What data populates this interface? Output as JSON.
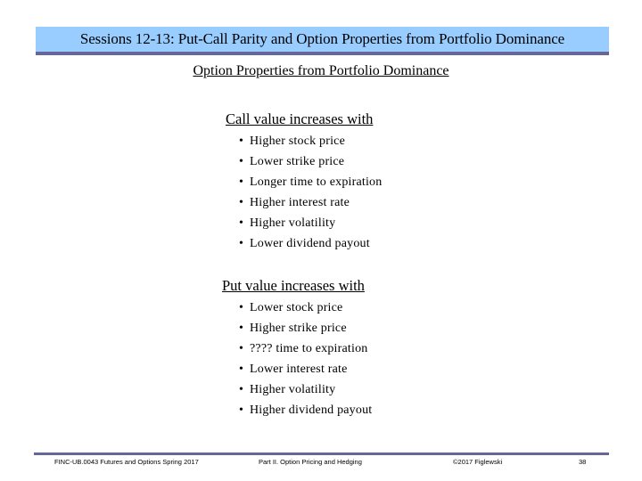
{
  "header": {
    "title": "Sessions 12-13:  Put-Call Parity and Option Properties from Portfolio Dominance",
    "band_color": "#99ccff",
    "rule_color": "#666699"
  },
  "subtitle": "Option Properties from Portfolio Dominance",
  "call_section": {
    "heading": "Call value increases with",
    "items": [
      "Higher stock price",
      "Lower strike price",
      "Longer time to expiration",
      "Higher interest rate",
      "Higher volatility",
      "Lower dividend payout"
    ]
  },
  "put_section": {
    "heading": "Put value increases with",
    "items": [
      "Lower stock price",
      "Higher strike price",
      "???? time to expiration",
      "Lower interest rate",
      "Higher volatility",
      "Higher dividend payout"
    ]
  },
  "bullet_glyph": "•",
  "footer": {
    "course": "FINC-UB.0043  Futures and Options  Spring 2017",
    "part": "Part II. Option Pricing and Hedging",
    "copyright": "©2017 Figlewski",
    "page": "38"
  }
}
